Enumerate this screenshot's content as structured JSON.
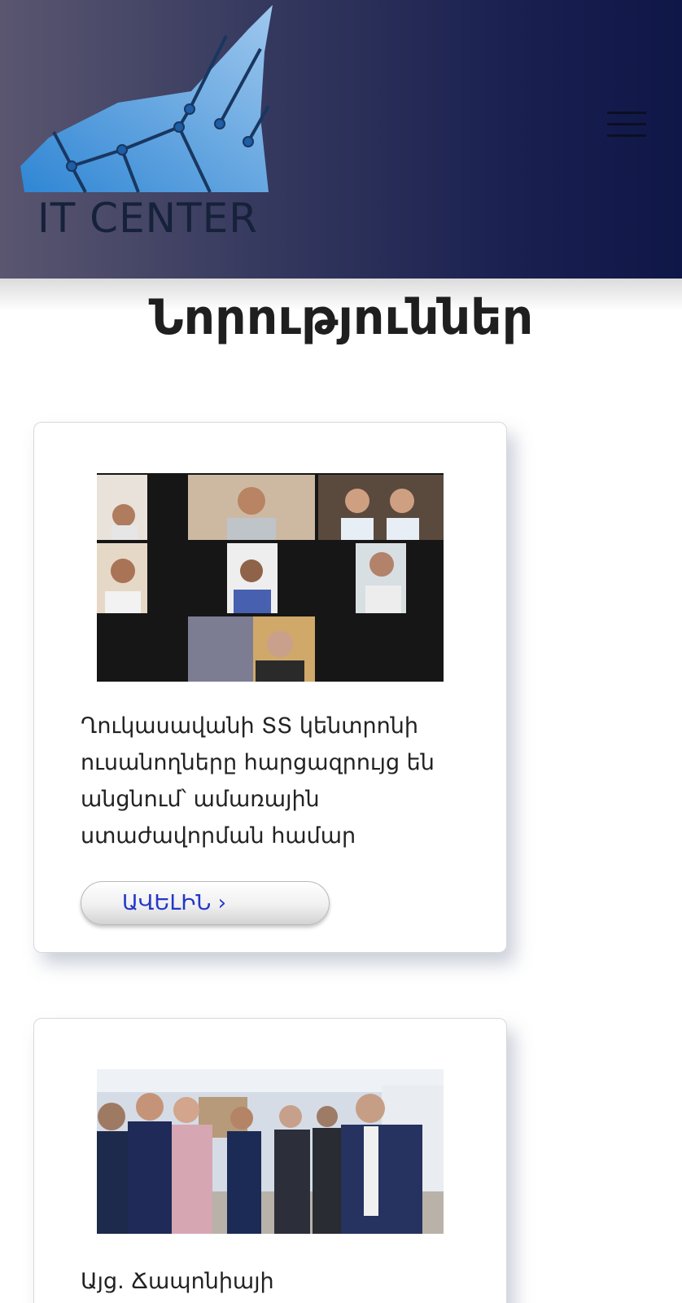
{
  "header": {
    "logo_text": "IT CENTER",
    "menu_icon": "hamburger-menu-icon"
  },
  "page": {
    "title": "Նորություններ"
  },
  "news": [
    {
      "title": "Ղուկասավանի ՏՏ կենտրոնի ուսանողները հարցազրույց են անցնում՝ ամառային ստաժավորման համար",
      "image": "video-conference-grid-photo",
      "more_label": "ԱՎԵԼԻՆ ›"
    },
    {
      "title": "Այց. Ճապոնիայի",
      "image": "group-toast-photo"
    }
  ],
  "colors": {
    "header_left": "#5a5670",
    "header_right": "#0f1748",
    "logo_blue": "#3d8fd8",
    "link_blue": "#2437c8"
  }
}
